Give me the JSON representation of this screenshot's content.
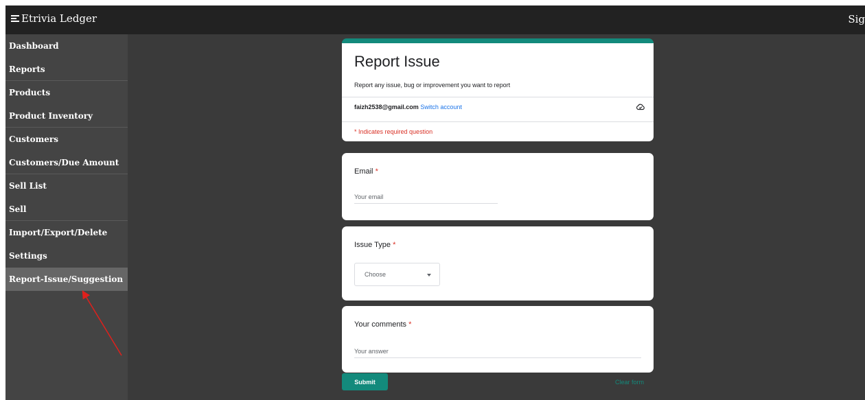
{
  "app": {
    "title": "Etrivia Ledger",
    "signin_label": "Sig"
  },
  "sidebar": {
    "items": [
      {
        "label": "Dashboard"
      },
      {
        "label": "Reports"
      },
      {
        "label": "Products"
      },
      {
        "label": "Product Inventory"
      },
      {
        "label": "Customers"
      },
      {
        "label": "Customers/Due Amount"
      },
      {
        "label": "Sell List"
      },
      {
        "label": "Sell"
      },
      {
        "label": "Import/Export/Delete"
      },
      {
        "label": "Settings"
      },
      {
        "label": "Report-Issue/Suggestion"
      }
    ],
    "active": "Report-Issue/Suggestion"
  },
  "form": {
    "title": "Report Issue",
    "description": "Report any issue, bug or improvement you want to report",
    "account_email": "faizh2538@gmail.com",
    "switch_account": "Switch account",
    "required_note": "* Indicates required question",
    "email": {
      "label": "Email",
      "required_mark": "*",
      "placeholder": "Your email"
    },
    "issue_type": {
      "label": "Issue Type",
      "required_mark": "*",
      "selected": "Choose"
    },
    "comments": {
      "label": "Your comments",
      "required_mark": "*",
      "placeholder": "Your answer"
    },
    "submit_label": "Submit",
    "clear_label": "Clear form"
  },
  "colors": {
    "accent": "#138a7c",
    "required": "#d93025",
    "link": "#1a73e8",
    "annotation": "#e0201c"
  },
  "icons": {
    "menu": "menu-icon",
    "cloud": "cloud-done-icon",
    "dropdown": "caret-down-icon"
  }
}
